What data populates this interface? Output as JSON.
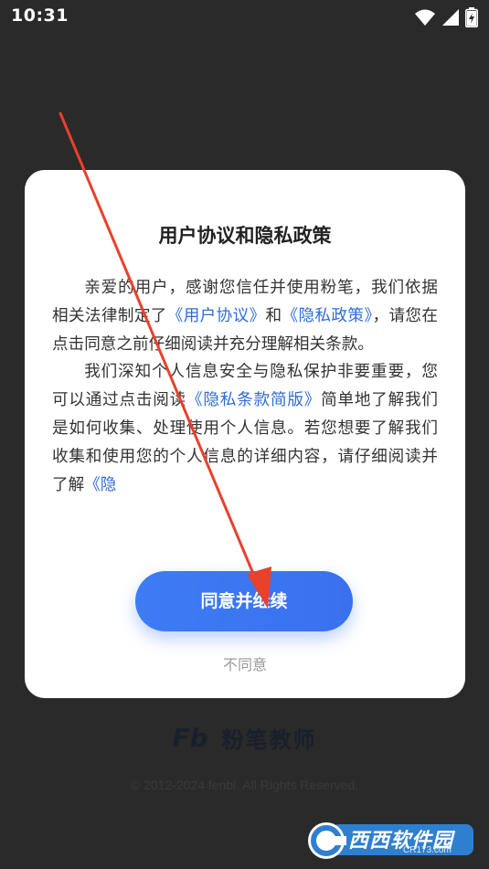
{
  "status_bar": {
    "time": "10:31",
    "icons": [
      "wifi-icon",
      "signal-icon",
      "battery-charging-icon"
    ]
  },
  "dialog": {
    "title": "用户协议和隐私政策",
    "paragraph1": {
      "part1": "亲爱的用户，感谢您信任并使用粉笔，我们依据相关法律制定了",
      "link_user_agreement": "《用户协议》",
      "part2": "和",
      "link_privacy_policy": "《隐私政策》",
      "part3": "，请您在点击同意之前仔细阅读并充分理解相关条款。"
    },
    "paragraph2": {
      "part1": "我们深知个人信息安全与隐私保护非要重要，您可以通过点击阅读",
      "link_privacy_brief": "《隐私条款简版》",
      "part2": "简单地了解我们是如何收集、处理使用个人信息。若您想要了解我们收集和使用您的个人信息的详细内容，请仔细阅读并了解",
      "link_privacy_tail": "《隐"
    },
    "agree_button": "同意并继续",
    "disagree_link": "不同意"
  },
  "brand": {
    "logo": "Fb",
    "name": "粉笔教师",
    "copyright": "© 2012-2024 fenbi. All Rights Reserved."
  },
  "watermark": {
    "text": "西西软件园",
    "sub": "CR173.com"
  },
  "colors": {
    "accent": "#3d7cf5",
    "link": "#2e6cd6",
    "background": "#2a2a2a",
    "annotation": "#e8412c"
  }
}
